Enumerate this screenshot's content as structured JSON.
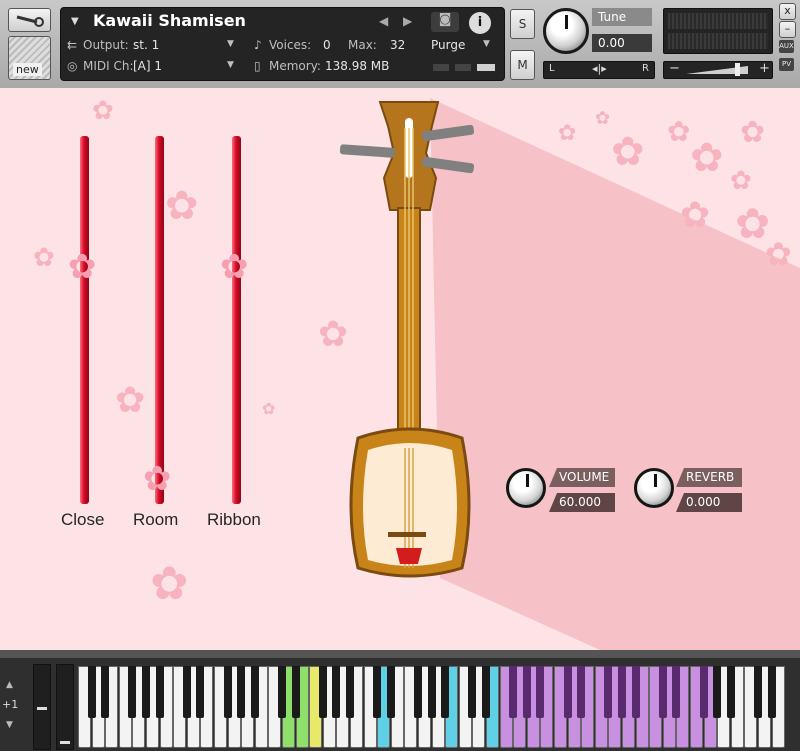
{
  "instrument": {
    "name": "Kawaii Shamisen",
    "output_label": "Output:",
    "output_value": "st. 1",
    "voices_label": "Voices:",
    "voices_value": "0",
    "max_label": "Max:",
    "max_value": "32",
    "purge_label": "Purge",
    "midi_label": "MIDI Ch:",
    "midi_value": "[A]  1",
    "memory_label": "Memory:",
    "memory_value": "138.98 MB"
  },
  "left_tools": {
    "new_label": "new"
  },
  "solo_mute": {
    "solo": "S",
    "mute": "M"
  },
  "tune": {
    "label": "Tune",
    "value": "0.00",
    "pan_left": "L",
    "pan_right": "R"
  },
  "side_buttons": {
    "close": "x",
    "minimize": "–",
    "aux": "AUX",
    "pv": "PV"
  },
  "level": {
    "minus": "−",
    "plus": "+"
  },
  "sliders": [
    {
      "label": "Close",
      "level": 0.78
    },
    {
      "label": "Room",
      "level": 0.05
    },
    {
      "label": "Ribbon",
      "level": 0.78
    }
  ],
  "controls": {
    "volume_label": "VOLUME",
    "volume_value": "60.000",
    "reverb_label": "REVERB",
    "reverb_value": "0.000"
  },
  "keyboard": {
    "octave": "+1",
    "key_colors": {
      "green": "#8fe06b",
      "yellow": "#e8e86b",
      "cyan": "#5fd0e6",
      "purple": "#c98fe0",
      "white": "#f3f3f3",
      "black": "#1a1a1a"
    }
  },
  "colors": {
    "background": "#fde3e6",
    "accent": "#d40b25"
  }
}
